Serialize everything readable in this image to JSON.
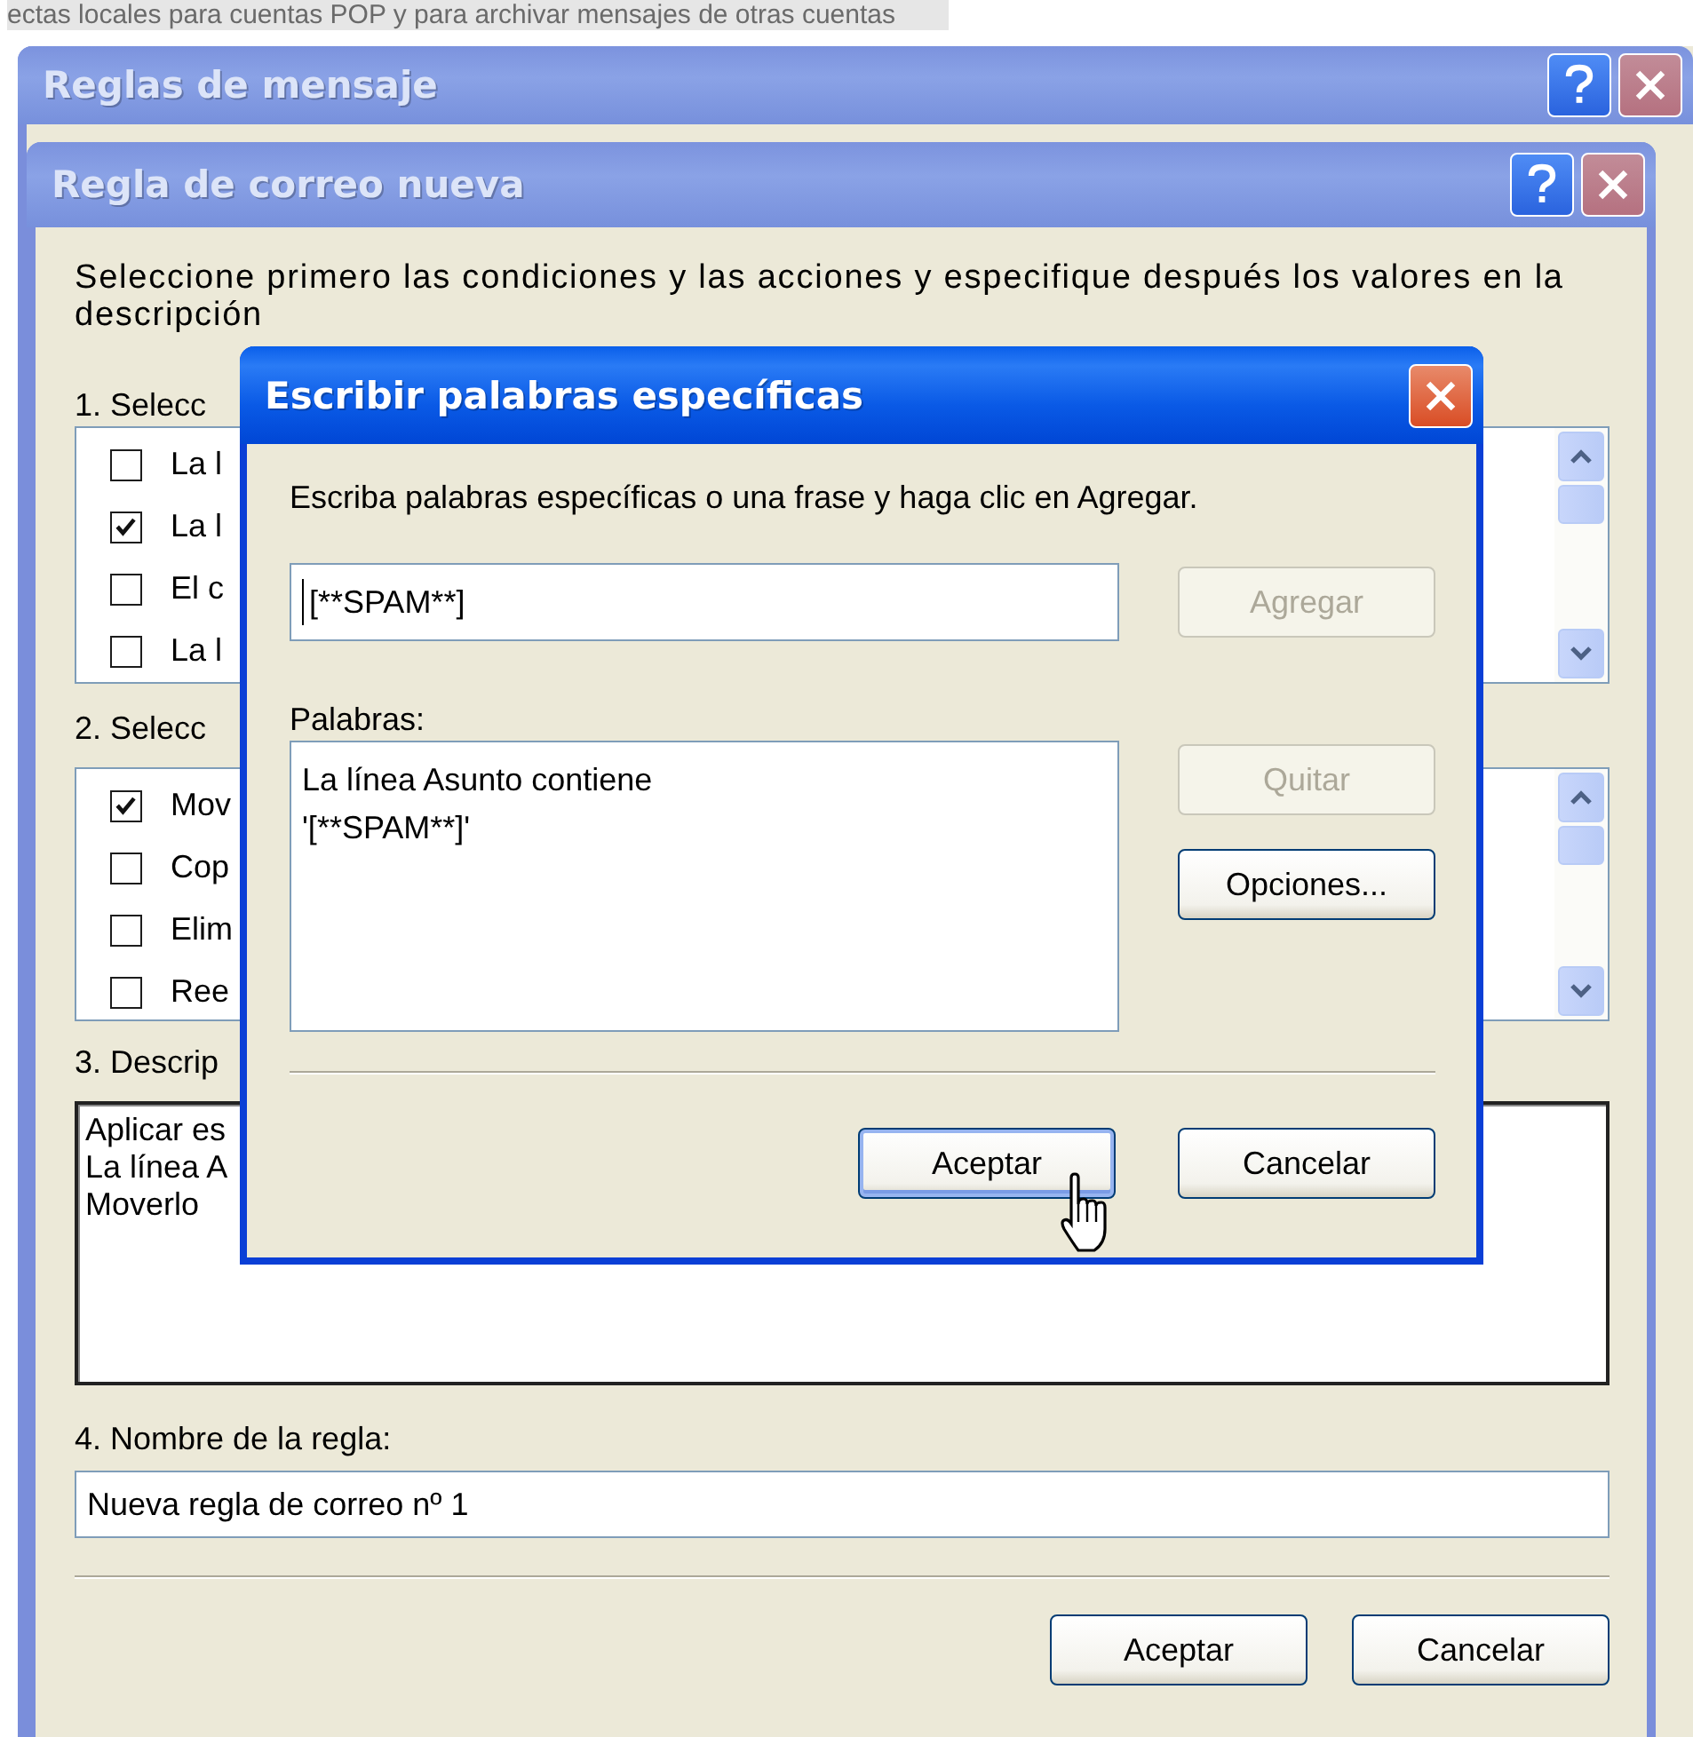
{
  "background_window": {
    "text": "ectas locales para cuentas POP y para archivar mensajes de otras cuentas",
    "title": "Reglas de mensaje"
  },
  "rule_window": {
    "title": "Regla de correo nueva",
    "instructions": "Seleccione primero las condiciones y las acciones y especifique después los valores en la descripción",
    "conditions_label": "1. Selecc",
    "conditions": [
      {
        "label": "La l",
        "checked": false
      },
      {
        "label": "La l",
        "checked": true
      },
      {
        "label": "El c",
        "checked": false
      },
      {
        "label": "La l",
        "checked": false
      }
    ],
    "actions_label": "2. Selecc",
    "actions": [
      {
        "label": "Mov",
        "checked": true
      },
      {
        "label": "Cop",
        "checked": false
      },
      {
        "label": "Elim",
        "checked": false
      },
      {
        "label": "Ree",
        "checked": false
      }
    ],
    "description_label": "3. Descrip",
    "description_lines": [
      "Aplicar es",
      "La línea A",
      "Moverlo"
    ],
    "name_label": "4. Nombre de la regla:",
    "name_value": "Nueva regla de correo nº 1",
    "buttons": [
      {
        "label": "Aceptar"
      },
      {
        "label": "Cancelar"
      }
    ]
  },
  "words_dialog": {
    "title": "Escribir palabras específicas",
    "instructions": "Escriba palabras específicas o una frase y haga clic en Agregar.",
    "word_value": "[**SPAM**]",
    "add_button": {
      "label": "Agregar",
      "disabled": true
    },
    "words_label": "Palabras:",
    "words_lines": [
      "La línea Asunto contiene",
      "'[**SPAM**]'"
    ],
    "remove_button": {
      "label": "Quitar",
      "disabled": true
    },
    "options_button": {
      "label": "Opciones...",
      "disabled": false
    },
    "buttons": [
      {
        "label": "Aceptar",
        "default": true
      },
      {
        "label": "Cancelar",
        "default": false
      }
    ]
  }
}
